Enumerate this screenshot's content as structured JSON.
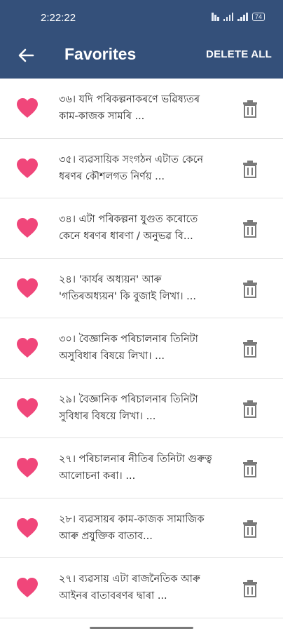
{
  "status_bar": {
    "time": "2:22:22",
    "network_label": "",
    "battery": "74"
  },
  "app_bar": {
    "title": "Favorites",
    "delete_all_label": "DELETE ALL",
    "back_icon": "arrow-left-icon"
  },
  "colors": {
    "app_bar_bg": "#34507a",
    "heart": "#f0467a",
    "trash": "#7a7a7a"
  },
  "favorites": [
    {
      "text": "৩৬। যদি পৰিকল্পনাকৰণে ভৱিষ্যতৰ কাম-কাজক সামৰি ..."
    },
    {
      "text": "৩৫। ব্যৱসায়িক সংগঠন এটাত কেনে ধৰণৰ কৌশলগত নিৰ্ণয় ..."
    },
    {
      "text": "৩৪। এটা পৰিকল্পনা যুগুত কৰোতে কেনে ধৰণৰ ধাৰণা / অনুভৱ বি..."
    },
    {
      "text": "২৪। 'কাৰ্যৰ অধ্যয়ন' আৰু 'গতিৰঅধ্যয়ন' কি বুজাই লিখা। ..."
    },
    {
      "text": "৩০। বৈজ্ঞানিক পৰিচালনাৰ তিনিটা অসুবিধাৰ বিষয়ে লিখা। ..."
    },
    {
      "text": "২৯। বৈজ্ঞানিক পৰিচালনাৰ তিনিটা সুবিধাৰ বিষয়ে লিখা। ..."
    },
    {
      "text": "২৭। পৰিচালনাৰ নীতিৰ তিনিটা গুৰুত্ব আলোচনা কৰা। ..."
    },
    {
      "text": "২৮। ব্যৱসায়ৰ কাম-কাজক সামাজিক আৰু প্ৰযুক্তিক বাতাব..."
    },
    {
      "text": "২৭। ব্যৱসায় এটা ৰাজনৈতিক আৰু আইনৰ বাতাবৰণৰ দ্বাৰা ..."
    }
  ]
}
